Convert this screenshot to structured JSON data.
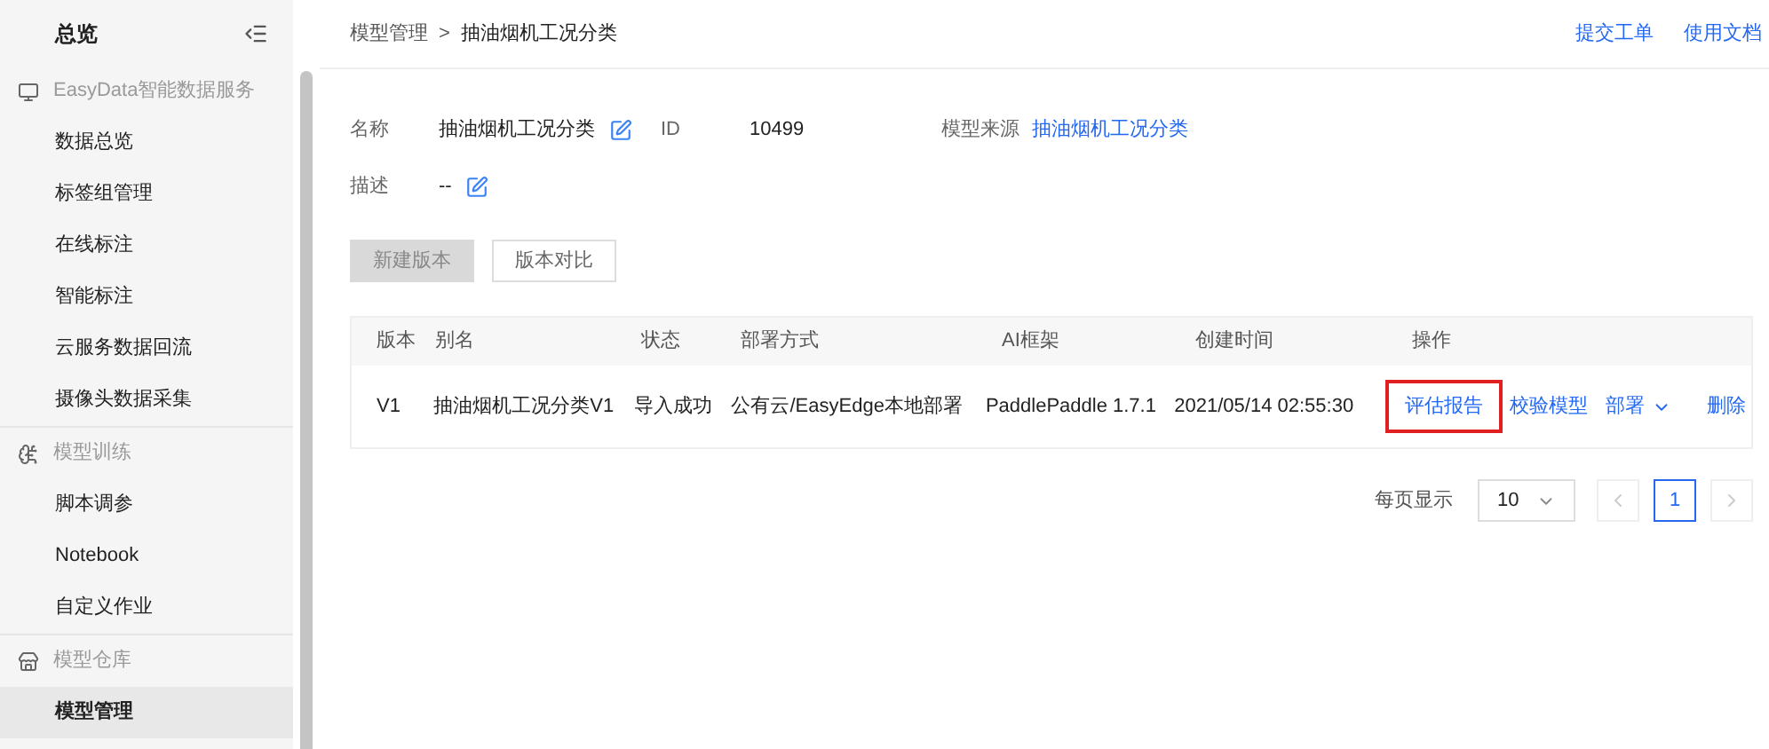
{
  "sidebar": {
    "title": "总览",
    "groups": [
      {
        "label": "EasyData智能数据服务",
        "items": [
          {
            "label": "数据总览",
            "selected": false
          },
          {
            "label": "标签组管理",
            "selected": false
          },
          {
            "label": "在线标注",
            "selected": false
          },
          {
            "label": "智能标注",
            "selected": false
          },
          {
            "label": "云服务数据回流",
            "selected": false
          },
          {
            "label": "摄像头数据采集",
            "selected": false
          }
        ]
      },
      {
        "label": "模型训练",
        "items": [
          {
            "label": "脚本调参",
            "selected": false
          },
          {
            "label": "Notebook",
            "selected": false
          },
          {
            "label": "自定义作业",
            "selected": false
          }
        ]
      },
      {
        "label": "模型仓库",
        "items": [
          {
            "label": "模型管理",
            "selected": true
          }
        ]
      }
    ]
  },
  "breadcrumb": {
    "parent": "模型管理",
    "separator": ">",
    "current": "抽油烟机工况分类"
  },
  "header_links": [
    "提交工单",
    "使用文档"
  ],
  "info": {
    "name_label": "名称",
    "name": "抽油烟机工况分类",
    "id_label": "ID",
    "id": "10499",
    "source_label": "模型来源",
    "source": "抽油烟机工况分类",
    "desc_label": "描述",
    "desc": "--"
  },
  "buttons": [
    {
      "label": "新建版本",
      "disabled": true
    },
    {
      "label": "版本对比",
      "disabled": false
    }
  ],
  "table": {
    "columns": [
      "版本",
      "别名",
      "状态",
      "部署方式",
      "AI框架",
      "创建时间",
      "操作"
    ],
    "rows": [
      {
        "cells": [
          "V1",
          "抽油烟机工况分类V1",
          "导入成功",
          "公有云/EasyEdge本地部署",
          "PaddlePaddle 1.7.1",
          "2021/05/14 02:55:30"
        ],
        "actions": [
          {
            "label": "评估报告",
            "kind": "link",
            "highlighted": true
          },
          {
            "label": "校验模型",
            "kind": "link",
            "highlighted": false
          },
          {
            "label": "部署",
            "kind": "dropdown",
            "highlighted": false
          },
          {
            "label": "删除",
            "kind": "link",
            "highlighted": false
          }
        ]
      }
    ]
  },
  "pagination": {
    "page_size_label": "每页显示",
    "page_size": "10",
    "pages": [
      {
        "label": "1",
        "selected": true
      }
    ]
  }
}
